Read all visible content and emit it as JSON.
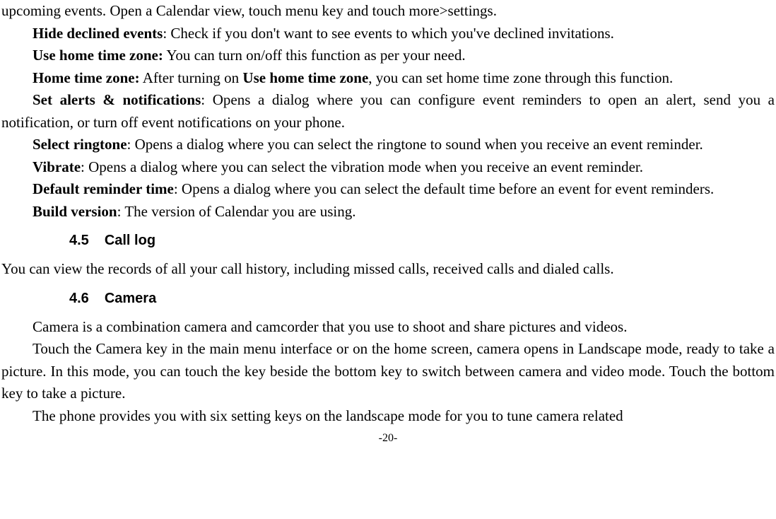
{
  "p_intro": "upcoming events. Open a Calendar view, touch menu key and touch more>settings.",
  "hide_declined_label": "Hide declined events",
  "hide_declined_text": ": Check if you don't want to see events to which you've declined invitations.",
  "use_home_tz_label": "Use home time zone:",
  "use_home_tz_text": " You can turn on/off this function as per your need.",
  "home_tz_label": "Home time zone:",
  "home_tz_text1": " After turning on ",
  "home_tz_bold_inline": "Use home time zone",
  "home_tz_text2": ", you can set home time zone through this function.",
  "alerts_label": "Set alerts & notifications",
  "alerts_text": ": Opens a dialog where you can configure event reminders to open an alert, send you a notification, or turn off event notifications on your phone.",
  "ringtone_label": "Select ringtone",
  "ringtone_text": ": Opens a dialog where you can select the ringtone to sound when you receive an event reminder.",
  "vibrate_label": "Vibrate",
  "vibrate_text": ": Opens a dialog where you can select the vibration mode when you receive an event reminder.",
  "default_reminder_label": "Default reminder time",
  "default_reminder_text": ": Opens a dialog where you can select the default time before an event for event reminders.",
  "build_label": "Build version",
  "build_text": ": The version of Calendar you are using.",
  "h45_num": "4.5",
  "h45_title": "Call log",
  "calllog_text": "You can view the records of all your call history, including missed calls, received calls and dialed calls.",
  "h46_num": "4.6",
  "h46_title": "Camera",
  "camera_p1": "Camera is a combination camera and camcorder that you use to shoot and share pictures and videos.",
  "camera_p2": "Touch the Camera key in the main menu interface or on the home screen, camera opens in Landscape mode, ready to take a picture. In this mode, you can touch the key beside the bottom key to switch between camera and video mode. Touch the bottom key to take a picture.",
  "camera_p3": "The phone provides you with six setting keys on the landscape mode for you to tune camera related",
  "page_number": "-20-"
}
